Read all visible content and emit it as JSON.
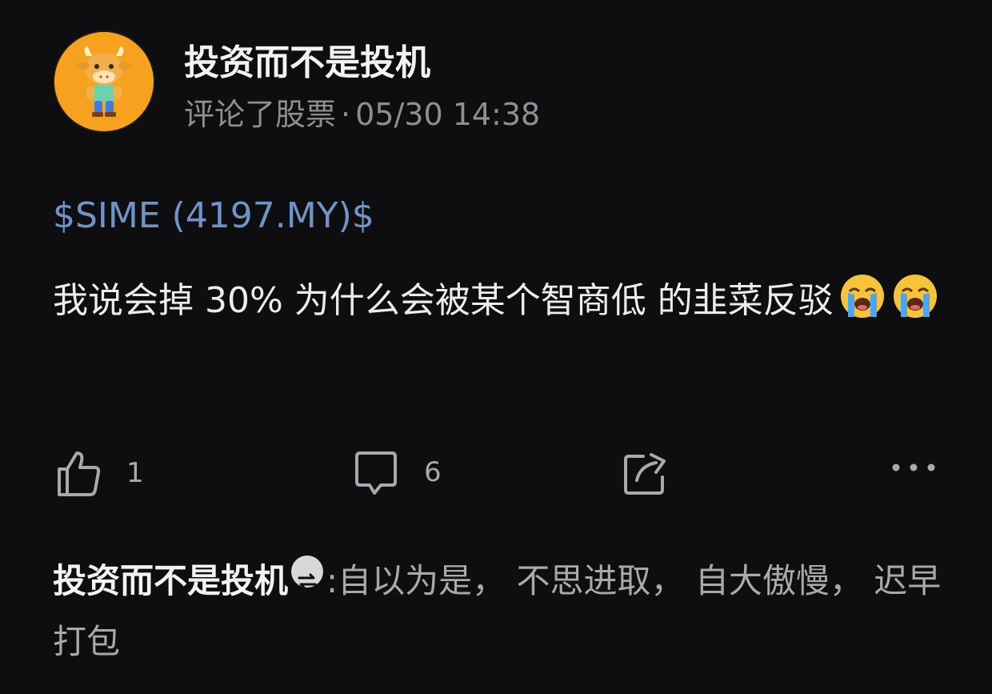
{
  "post": {
    "author": "投资而不是投机",
    "action": "评论了股票",
    "separator": "·",
    "timestamp": "05/30 14:38",
    "ticker": "$SIME (4197.MY)$",
    "text": "我说会掉 30% 为什么会被某个智商低 的韭菜反驳",
    "emojis": [
      "loudly-crying-face-icon",
      "loudly-crying-face-icon"
    ]
  },
  "actions": {
    "like_count": "1",
    "comment_count": "6"
  },
  "reply": {
    "author": "投资而不是投机",
    "colon": ":",
    "text": "自以为是， 不思进取， 自大傲慢， 迟早打包"
  },
  "colors": {
    "background": "#0e0e10",
    "ticker_link": "#6f95c8",
    "secondary_text": "#8e8e93",
    "avatar_bg": "#f6a21f"
  }
}
